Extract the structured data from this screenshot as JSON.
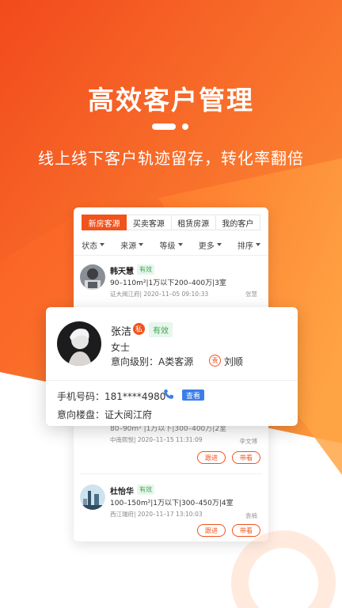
{
  "hero": {
    "title": "高效客户管理",
    "subtitle": "线上线下客户轨迹留存，转化率翻倍"
  },
  "colors": {
    "accent": "#f2521b",
    "accent_light": "#ff8a3d",
    "valid": "#3aa856",
    "view_btn": "#3b7ee8"
  },
  "tabs": [
    {
      "label": "新房客源",
      "active": true
    },
    {
      "label": "买卖客源",
      "active": false
    },
    {
      "label": "租赁房源",
      "active": false
    },
    {
      "label": "我的客户",
      "active": false
    }
  ],
  "filters": [
    "状态",
    "来源",
    "等级",
    "更多",
    "排序"
  ],
  "customers": [
    {
      "name": "韩天慧",
      "status": "有效",
      "info": "90–110m²|1万以下200–400万|3室",
      "meta": "证大阅江府| 2020–11–05 09:10:33",
      "agent": "张慧"
    },
    {
      "name": "",
      "status": "",
      "info": "80–90m² |1万以下|300–400万|2室",
      "meta": "中南熙悦| 2020–11–15 11:31:09",
      "agent": "李文博",
      "actions": [
        "跟进",
        "带看"
      ]
    },
    {
      "name": "杜怡华",
      "status": "有效",
      "info": "100–150m²|1万以下|300–450万|4室",
      "meta": "西江瑞府| 2020–11–17 13:10:03",
      "agent": "袁楠",
      "actions": [
        "跟进",
        "带看"
      ]
    }
  ],
  "popup": {
    "name": "张洁",
    "private_tag": "私",
    "status": "有效",
    "gender": "女士",
    "level": "意向级别：A类客源",
    "responsible_tag": "责",
    "responsible": "刘顺",
    "phone": "手机号码：181****4980",
    "view_label": "查看",
    "project": "意向楼盘：证大阅江府"
  }
}
